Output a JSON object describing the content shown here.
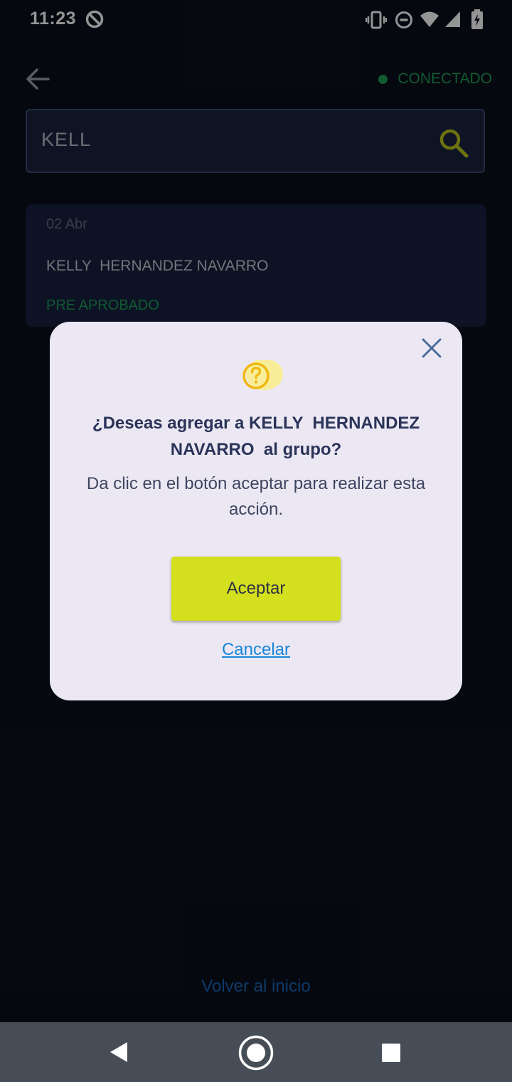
{
  "status_bar": {
    "time": "11:23",
    "icons": [
      "data-saver-icon",
      "vibrate-icon",
      "do-not-disturb-icon",
      "wifi-icon",
      "signal-icon",
      "battery-charging-icon"
    ]
  },
  "header": {
    "back_icon": "arrow-left-icon",
    "connection_status": "CONECTADO",
    "connection_color": "#1e9e55"
  },
  "search": {
    "value": "KELL",
    "icon": "search-icon",
    "icon_color": "#b8c41a"
  },
  "results": [
    {
      "date": "02 Abr",
      "name": "KELLY  HERNANDEZ NAVARRO",
      "status": "PRE APROBADO"
    }
  ],
  "footer": {
    "home_link": "Volver al inicio"
  },
  "dialog": {
    "icon": "question-circle-icon",
    "title": "¿Deseas agregar a KELLY  HERNANDEZ NAVARRO  al grupo?",
    "message": "Da clic en el botón aceptar para realizar esta acción.",
    "accept_label": "Aceptar",
    "cancel_label": "Cancelar",
    "accent_color": "#d4e01d"
  },
  "nav_bar": {
    "icons": [
      "nav-back-icon",
      "nav-home-icon",
      "nav-recents-icon"
    ]
  }
}
